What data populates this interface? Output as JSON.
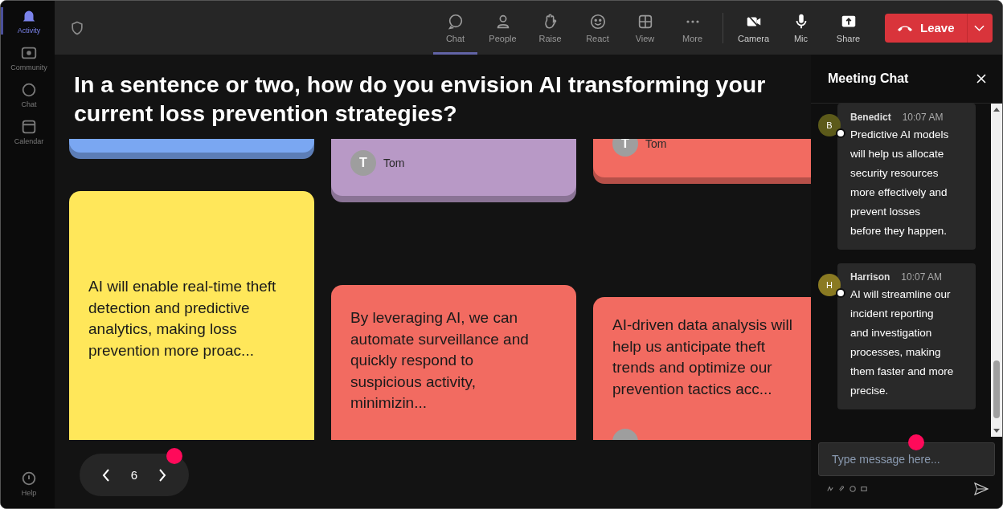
{
  "rail": {
    "items": [
      {
        "label": "Activity",
        "selected": true
      },
      {
        "label": "Community",
        "selected": false
      },
      {
        "label": "Chat",
        "selected": false
      },
      {
        "label": "Calendar",
        "selected": false
      }
    ],
    "help": {
      "label": "Help"
    }
  },
  "toolbar": {
    "items": [
      {
        "label": "Chat",
        "selected": true
      },
      {
        "label": "People",
        "selected": false
      },
      {
        "label": "Raise",
        "selected": false
      },
      {
        "label": "React",
        "selected": false
      },
      {
        "label": "View",
        "selected": false
      },
      {
        "label": "More",
        "selected": false
      }
    ],
    "devices": [
      {
        "label": "Camera"
      },
      {
        "label": "Mic"
      },
      {
        "label": "Share"
      }
    ],
    "leave": {
      "label": "Leave"
    }
  },
  "question": "In a sentence or two, how do you envision AI transforming your current loss prevention strategies?",
  "columns": [
    {
      "cards": [
        {
          "color": "#7aa7f2"
        },
        {
          "color": "#ffe75a",
          "text": "AI will enable real-time theft detection and predictive analytics, making loss prevention more proac..."
        }
      ]
    },
    {
      "cards": [
        {
          "color": "#b899c6",
          "author": {
            "initial": "T",
            "name": "Tom"
          }
        },
        {
          "color": "#f26b61",
          "text": "By leveraging AI, we can automate surveillance and quickly respond to suspicious activity, minimizin..."
        }
      ]
    },
    {
      "cards": [
        {
          "color": "#f26b61",
          "author": {
            "initial": "T",
            "name": "Tom"
          }
        },
        {
          "color": "#f26b61",
          "text": "AI-driven data analysis will help us anticipate theft trends and optimize our prevention tactics acc..."
        }
      ]
    }
  ],
  "pager": {
    "page": "6"
  },
  "chat": {
    "title": "Meeting Chat",
    "messages": [
      {
        "initial": "B",
        "color": "#5c5a1a",
        "name": "Benedict",
        "time": "10:07 AM",
        "text": "Predictive AI models will help us allocate security resources more effectively and prevent losses before they happen."
      },
      {
        "initial": "H",
        "color": "#8a7a22",
        "name": "Harrison",
        "time": "10:07 AM",
        "text": "AI will streamline our incident reporting and investigation processes, making them faster and more precise."
      }
    ],
    "input": {
      "placeholder": "Type message here..."
    }
  }
}
